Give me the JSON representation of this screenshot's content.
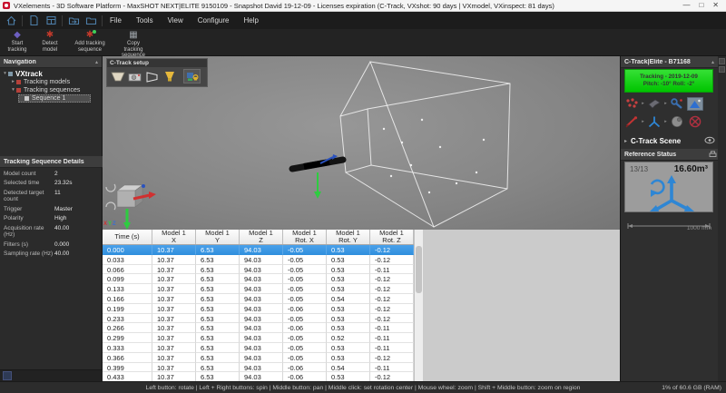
{
  "window": {
    "title": "VXelements - 3D Software Platform - MaxSHOT NEXT|ELITE 9150109 - Snapshot David 19-12-09 - Licenses expiration (C-Track, VXshot: 90 days | VXmodel, VXinspect: 81 days)",
    "menus": [
      "File",
      "Tools",
      "View",
      "Configure",
      "Help"
    ],
    "controls": {
      "minimize": "—",
      "maximize": "□",
      "close": "✕"
    }
  },
  "toolbar": {
    "buttons": [
      {
        "icon": "start-tracking",
        "label": "Start tracking"
      },
      {
        "icon": "detect-model",
        "label": "Detect model"
      },
      {
        "icon": "add-tracking-sequence",
        "label": "Add tracking sequence"
      },
      {
        "icon": "copy-tracking-sequence",
        "label": "Copy tracking sequence"
      }
    ]
  },
  "navigation": {
    "title": "Navigation",
    "tree": [
      {
        "label": "VXtrack",
        "level": 0,
        "expander": "▾",
        "bold": true,
        "icon_color": "#7f98a8",
        "selected": false
      },
      {
        "label": "Tracking models",
        "level": 1,
        "expander": "▸",
        "bold": false,
        "icon_color": "#b5413a",
        "selected": false
      },
      {
        "label": "Tracking sequences",
        "level": 1,
        "expander": "▾",
        "bold": false,
        "icon_color": "#b5413a",
        "selected": false
      },
      {
        "label": "Sequence 1",
        "level": 2,
        "expander": "",
        "bold": false,
        "icon_color": "#c9c9c9",
        "selected": true
      }
    ]
  },
  "details": {
    "title": "Tracking Sequence Details",
    "rows": [
      {
        "label": "Model count",
        "value": "2"
      },
      {
        "label": "Selected time",
        "value": "23.32s"
      },
      {
        "label": "Detected target count",
        "value": "11"
      },
      {
        "label": "Trigger",
        "value": "Master"
      },
      {
        "label": "Polarity",
        "value": "High"
      },
      {
        "label": "Acquisition rate (Hz)",
        "value": "40.00"
      },
      {
        "label": "Filters (s)",
        "value": "0.000"
      },
      {
        "label": "Sampling rate (Hz)",
        "value": "40.00"
      }
    ]
  },
  "viewport": {
    "setup_panel_title": "C-Track setup",
    "setup_icons": [
      "measurement-volume",
      "camera",
      "side-volume",
      "projector-lamp",
      "locked-camera"
    ],
    "axis_labels": {
      "x": "X",
      "y": "Y",
      "z": "Z"
    }
  },
  "ctrack_panel": {
    "title": "C-Track|Elite - B71168",
    "status_line1": "Tracking - 2019-12-09",
    "status_line2": "Pitch: -10°  Roll: -2°",
    "icons_row1": [
      "targets",
      "model",
      "wrench",
      "image"
    ],
    "icons_row2": [
      "probe",
      "triad",
      "sphere",
      "fan"
    ],
    "scene_label": "C-Track Scene",
    "reference": {
      "title": "Reference Status",
      "count": "13/13",
      "volume": "16.60m³"
    },
    "scale_label": "1000 mm"
  },
  "table": {
    "headers": [
      [
        "Time (s)",
        ""
      ],
      [
        "Model 1",
        "X"
      ],
      [
        "Model 1",
        "Y"
      ],
      [
        "Model 1",
        "Z"
      ],
      [
        "Model 1",
        "Rot. X"
      ],
      [
        "Model 1",
        "Rot. Y"
      ],
      [
        "Model 1",
        "Rot. Z"
      ]
    ],
    "selected_index": 0,
    "rows": [
      [
        "0.000",
        "10.37",
        "6.53",
        "94.03",
        "-0.05",
        "0.53",
        "-0.12"
      ],
      [
        "0.033",
        "10.37",
        "6.53",
        "94.03",
        "-0.05",
        "0.53",
        "-0.12"
      ],
      [
        "0.066",
        "10.37",
        "6.53",
        "94.03",
        "-0.05",
        "0.53",
        "-0.11"
      ],
      [
        "0.099",
        "10.37",
        "6.53",
        "94.03",
        "-0.05",
        "0.53",
        "-0.12"
      ],
      [
        "0.133",
        "10.37",
        "6.53",
        "94.03",
        "-0.05",
        "0.53",
        "-0.12"
      ],
      [
        "0.166",
        "10.37",
        "6.53",
        "94.03",
        "-0.05",
        "0.54",
        "-0.12"
      ],
      [
        "0.199",
        "10.37",
        "6.53",
        "94.03",
        "-0.06",
        "0.53",
        "-0.12"
      ],
      [
        "0.233",
        "10.37",
        "6.53",
        "94.03",
        "-0.05",
        "0.53",
        "-0.12"
      ],
      [
        "0.266",
        "10.37",
        "6.53",
        "94.03",
        "-0.06",
        "0.53",
        "-0.11"
      ],
      [
        "0.299",
        "10.37",
        "6.53",
        "94.03",
        "-0.05",
        "0.52",
        "-0.11"
      ],
      [
        "0.333",
        "10.37",
        "6.53",
        "94.03",
        "-0.05",
        "0.53",
        "-0.11"
      ],
      [
        "0.366",
        "10.37",
        "6.53",
        "94.03",
        "-0.05",
        "0.53",
        "-0.12"
      ],
      [
        "0.399",
        "10.37",
        "6.53",
        "94.03",
        "-0.06",
        "0.54",
        "-0.11"
      ],
      [
        "0.433",
        "10.37",
        "6.53",
        "94.03",
        "-0.06",
        "0.53",
        "-0.12"
      ]
    ]
  },
  "statusbar": {
    "hints": "Left button: rotate  |  Left + Right buttons: spin  |  Middle button: pan  |  Middle click: set rotation center  |  Mouse wheel: zoom  |  Shift + Middle button: zoom on region",
    "ram": "1% of 60.6 GB (RAM)"
  },
  "colors": {
    "accent": "#2f8fdd",
    "running_green": "#18d018",
    "axis_blue": "#2e86d4"
  }
}
